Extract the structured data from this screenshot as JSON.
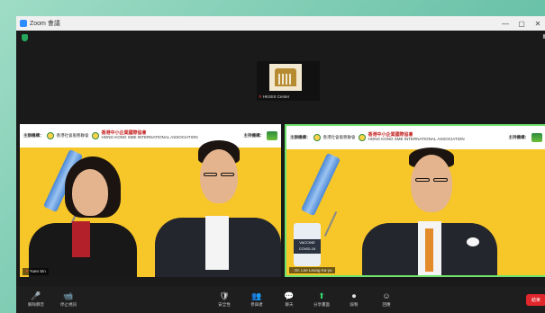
{
  "window": {
    "title": "Zoom 會議",
    "minimize": "—",
    "maximize": "▢",
    "close": "✕"
  },
  "stage": {
    "view_label": "▦"
  },
  "host": {
    "name": "HKSIIS Center"
  },
  "banner": {
    "organizer_label": "主辦機構：",
    "org1": "香港社會服務聯會",
    "org2_title": "香港中小企業國際協會",
    "org2_sub": "HONG KONG SME INTERNATIONAL ASSOCIATION",
    "co_label": "主持機構："
  },
  "participants": [
    {
      "name": "Yuen Sin"
    },
    {
      "name": "Dr. Lee Leung Ka-yu"
    }
  ],
  "vial_text": [
    "VACCINE",
    "COVID-19"
  ],
  "toolbar": {
    "items": [
      {
        "icon": "🎤",
        "label": "解除靜音"
      },
      {
        "icon": "📹",
        "label": "停止視訊"
      },
      {
        "icon": "🛡",
        "label": "安全性"
      },
      {
        "icon": "👥",
        "label": "參與者"
      },
      {
        "icon": "💬",
        "label": "聊天"
      },
      {
        "icon": "⬆",
        "label": "分享畫面"
      },
      {
        "icon": "⏺",
        "label": "錄製"
      },
      {
        "icon": "☺",
        "label": "回應"
      }
    ],
    "end_label": "結束"
  },
  "colors": {
    "accent": "#2d8cff",
    "active_speaker_border": "#6ee36e",
    "end_button": "#e0272b",
    "banner_yellow": "#f7c629"
  }
}
